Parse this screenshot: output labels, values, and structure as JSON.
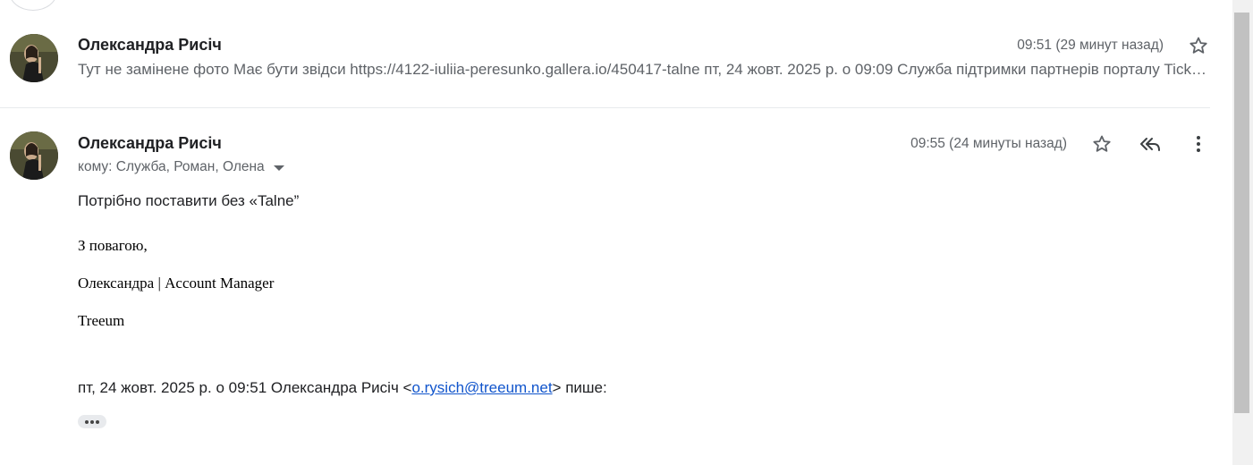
{
  "thread": {
    "messages": [
      {
        "sender": "Олександра Рисіч",
        "time": "09:51 (29 минут назад)",
        "snippet": "Тут не замінене фото Має бути звідси https://4122-iuliia-peresunko.gallera.io/450417-talne пт, 24 жовт. 2025 р. о 09:09 Служба підтримки партнерів порталу Ticketsbox.com <partners@ticketsbox.com> пише: Добрий день, Олександро! ",
        "star_icon": "star-outline-icon"
      },
      {
        "sender": "Олександра Рисіч",
        "time": "09:55 (24 минуты назад)",
        "recipients": "кому: Служба, Роман, Олена",
        "body_line": "Потрібно поставити без «Talne”",
        "signature": {
          "greeting": "З повагою,",
          "name_title": "Олександра | Account Manager",
          "company": "Treeum"
        },
        "quote": {
          "prefix": "пт, 24 жовт. 2025 р. о 09:51 Олександра Рисіч <",
          "email": "o.rysich@treeum.net",
          "suffix": "> пише:"
        },
        "actions": [
          "star-icon",
          "reply-all-icon",
          "more-vert-icon"
        ]
      }
    ]
  }
}
